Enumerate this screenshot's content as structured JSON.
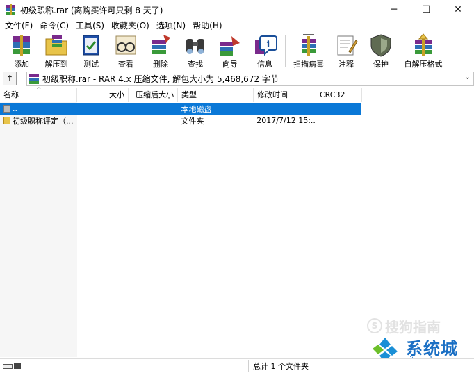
{
  "window": {
    "title": "初级职称.rar (离购买许可只剩 8 天了)",
    "controls": {
      "minimize": "─",
      "maximize": "☐",
      "close": "✕"
    }
  },
  "menu": [
    "文件(F)",
    "命令(C)",
    "工具(S)",
    "收藏夹(O)",
    "选项(N)",
    "帮助(H)"
  ],
  "toolbar": {
    "group1": [
      {
        "label": "添加",
        "icon": "add-books-icon"
      },
      {
        "label": "解压到",
        "icon": "extract-folder-icon"
      },
      {
        "label": "测试",
        "icon": "test-book-icon"
      },
      {
        "label": "查看",
        "icon": "view-glasses-icon"
      },
      {
        "label": "删除",
        "icon": "delete-book-icon"
      },
      {
        "label": "查找",
        "icon": "binoculars-icon"
      },
      {
        "label": "向导",
        "icon": "wizard-icon"
      },
      {
        "label": "信息",
        "icon": "info-icon"
      }
    ],
    "group2": [
      {
        "label": "扫描病毒",
        "icon": "scan-virus-icon"
      },
      {
        "label": "注释",
        "icon": "comment-icon"
      },
      {
        "label": "保护",
        "icon": "shield-icon"
      },
      {
        "label": "自解压格式",
        "icon": "sfx-archive-icon"
      }
    ]
  },
  "address": {
    "up_label": "↑",
    "path": "初级职称.rar - RAR 4.x 压缩文件, 解包大小为 5,468,672 字节",
    "dropdown": "⌄"
  },
  "columns": {
    "name": "名称",
    "size": "大小",
    "packed": "压缩后大小",
    "type": "类型",
    "mtime": "修改时间",
    "crc": "CRC32",
    "sort_indicator": "^"
  },
  "rows": [
    {
      "name": "..",
      "size": "",
      "packed": "",
      "type": "本地磁盘",
      "mtime": "",
      "crc": "",
      "icon": "drive-icon",
      "selected": true
    },
    {
      "name": "初级职称评定（...",
      "size": "",
      "packed": "",
      "type": "文件夹",
      "mtime": "2017/7/12 15:...",
      "crc": "",
      "icon": "folder-icon",
      "selected": false
    }
  ],
  "status": {
    "summary": "总计 1 个文件夹"
  },
  "watermarks": {
    "sogou": "搜狗指南",
    "sogou_mark": "S",
    "site_title": "系统城",
    "site_url": "xitongcheng.com"
  }
}
